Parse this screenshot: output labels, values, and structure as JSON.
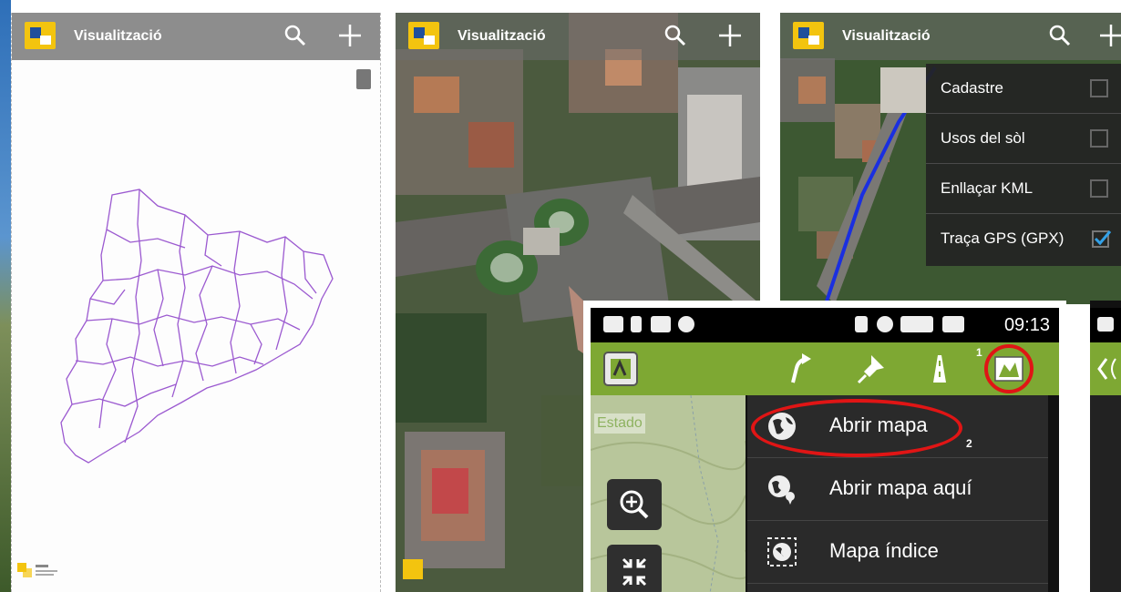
{
  "app": {
    "title": "Visualització"
  },
  "layers_menu": {
    "items": [
      {
        "label": "Cadastre",
        "checked": false
      },
      {
        "label": "Usos del sòl",
        "checked": false
      },
      {
        "label": "Enllaçar KML",
        "checked": false
      },
      {
        "label": "Traça GPS (GPX)",
        "checked": true
      }
    ]
  },
  "phone": {
    "status_time": "09:13",
    "map_status": "Estado",
    "menu_items": [
      {
        "label": "Abrir mapa",
        "icon": "globe-icon"
      },
      {
        "label": "Abrir mapa aquí",
        "icon": "globe-pin-icon"
      },
      {
        "label": "Mapa índice",
        "icon": "index-map-icon"
      }
    ],
    "annotations": {
      "step1": "1",
      "step2": "2"
    }
  },
  "colors": {
    "toolbar_green": "#7ea833",
    "highlight_red": "#e01515",
    "boundary_purple": "#9b59d0",
    "gps_track_blue": "#1a2fe0"
  }
}
